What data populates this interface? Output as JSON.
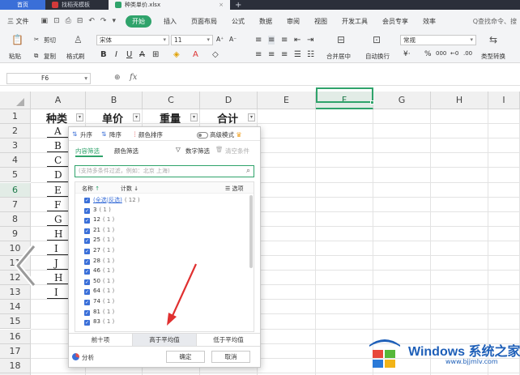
{
  "tabs": [
    {
      "label": "首页"
    },
    {
      "label": "找稻壳模板"
    },
    {
      "label": "种类单价.xlsx"
    }
  ],
  "menu": {
    "file": "三 文件",
    "start": "开始",
    "items": [
      "插入",
      "页面布局",
      "公式",
      "数据",
      "审阅",
      "视图",
      "开发工具",
      "会员专享",
      "效率"
    ],
    "search_cmd": "Q查找命令、搜"
  },
  "ribbon": {
    "paste": "粘贴",
    "cut": "剪切",
    "copy": "复制",
    "format_painter": "格式刷",
    "font_name": "宋体",
    "font_size": "11",
    "grow": "A⁺",
    "shrink": "A⁻",
    "merge": "合并居中",
    "wrap": "自动换行",
    "number_format": "常规",
    "convert": "类型转换",
    "percent": "%",
    "thousands": "000"
  },
  "formula": {
    "cell_ref": "F6",
    "fx": "fx"
  },
  "columns": [
    "A",
    "B",
    "C",
    "D",
    "E",
    "F",
    "G",
    "H",
    "I"
  ],
  "selected_column": "F",
  "rows": [
    "1",
    "2",
    "3",
    "4",
    "5",
    "6",
    "7",
    "8",
    "9",
    "10",
    "11",
    "12",
    "13",
    "14",
    "15",
    "16",
    "17",
    "18",
    "19"
  ],
  "selected_row": "6",
  "headers": [
    "种类",
    "单价",
    "重量",
    "合计"
  ],
  "col_a_values": [
    "A",
    "B",
    "C",
    "D",
    "E",
    "F",
    "G",
    "H",
    "I",
    "J",
    "H",
    "I"
  ],
  "filter_panel": {
    "sort_asc": "升序",
    "sort_desc": "降序",
    "sort_color": "颜色排序",
    "advanced_mode": "高级模式",
    "tab_content": "内容筛选",
    "tab_color": "颜色筛选",
    "number_filter": "数字筛选",
    "clear_filter": "清空条件",
    "search_placeholder": "(支持多条件过滤，例如：北京 上海)",
    "col_name": "名称",
    "col_count": "计数",
    "options": "选项",
    "select_all": "(全选|反选)",
    "select_all_count": "( 12 )",
    "items": [
      {
        "label": "3",
        "count": "( 1 )"
      },
      {
        "label": "12",
        "count": "( 1 )"
      },
      {
        "label": "21",
        "count": "( 1 )"
      },
      {
        "label": "25",
        "count": "( 1 )"
      },
      {
        "label": "27",
        "count": "( 1 )"
      },
      {
        "label": "28",
        "count": "( 1 )"
      },
      {
        "label": "46",
        "count": "( 1 )"
      },
      {
        "label": "50",
        "count": "( 1 )"
      },
      {
        "label": "64",
        "count": "( 1 )"
      },
      {
        "label": "74",
        "count": "( 1 )"
      },
      {
        "label": "81",
        "count": "( 1 )"
      },
      {
        "label": "83",
        "count": "( 1 )"
      }
    ],
    "top_ten": "前十项",
    "above_avg": "高于平均值",
    "below_avg": "低于平均值",
    "analysis": "分析",
    "ok": "确定",
    "cancel": "取消"
  },
  "watermark": {
    "title": "Windows 系统之家",
    "url": "www.bjjmlv.com"
  },
  "colors": {
    "accent_green": "#2fa36b",
    "accent_blue": "#3a6fd8",
    "arrow_red": "#e03030"
  }
}
